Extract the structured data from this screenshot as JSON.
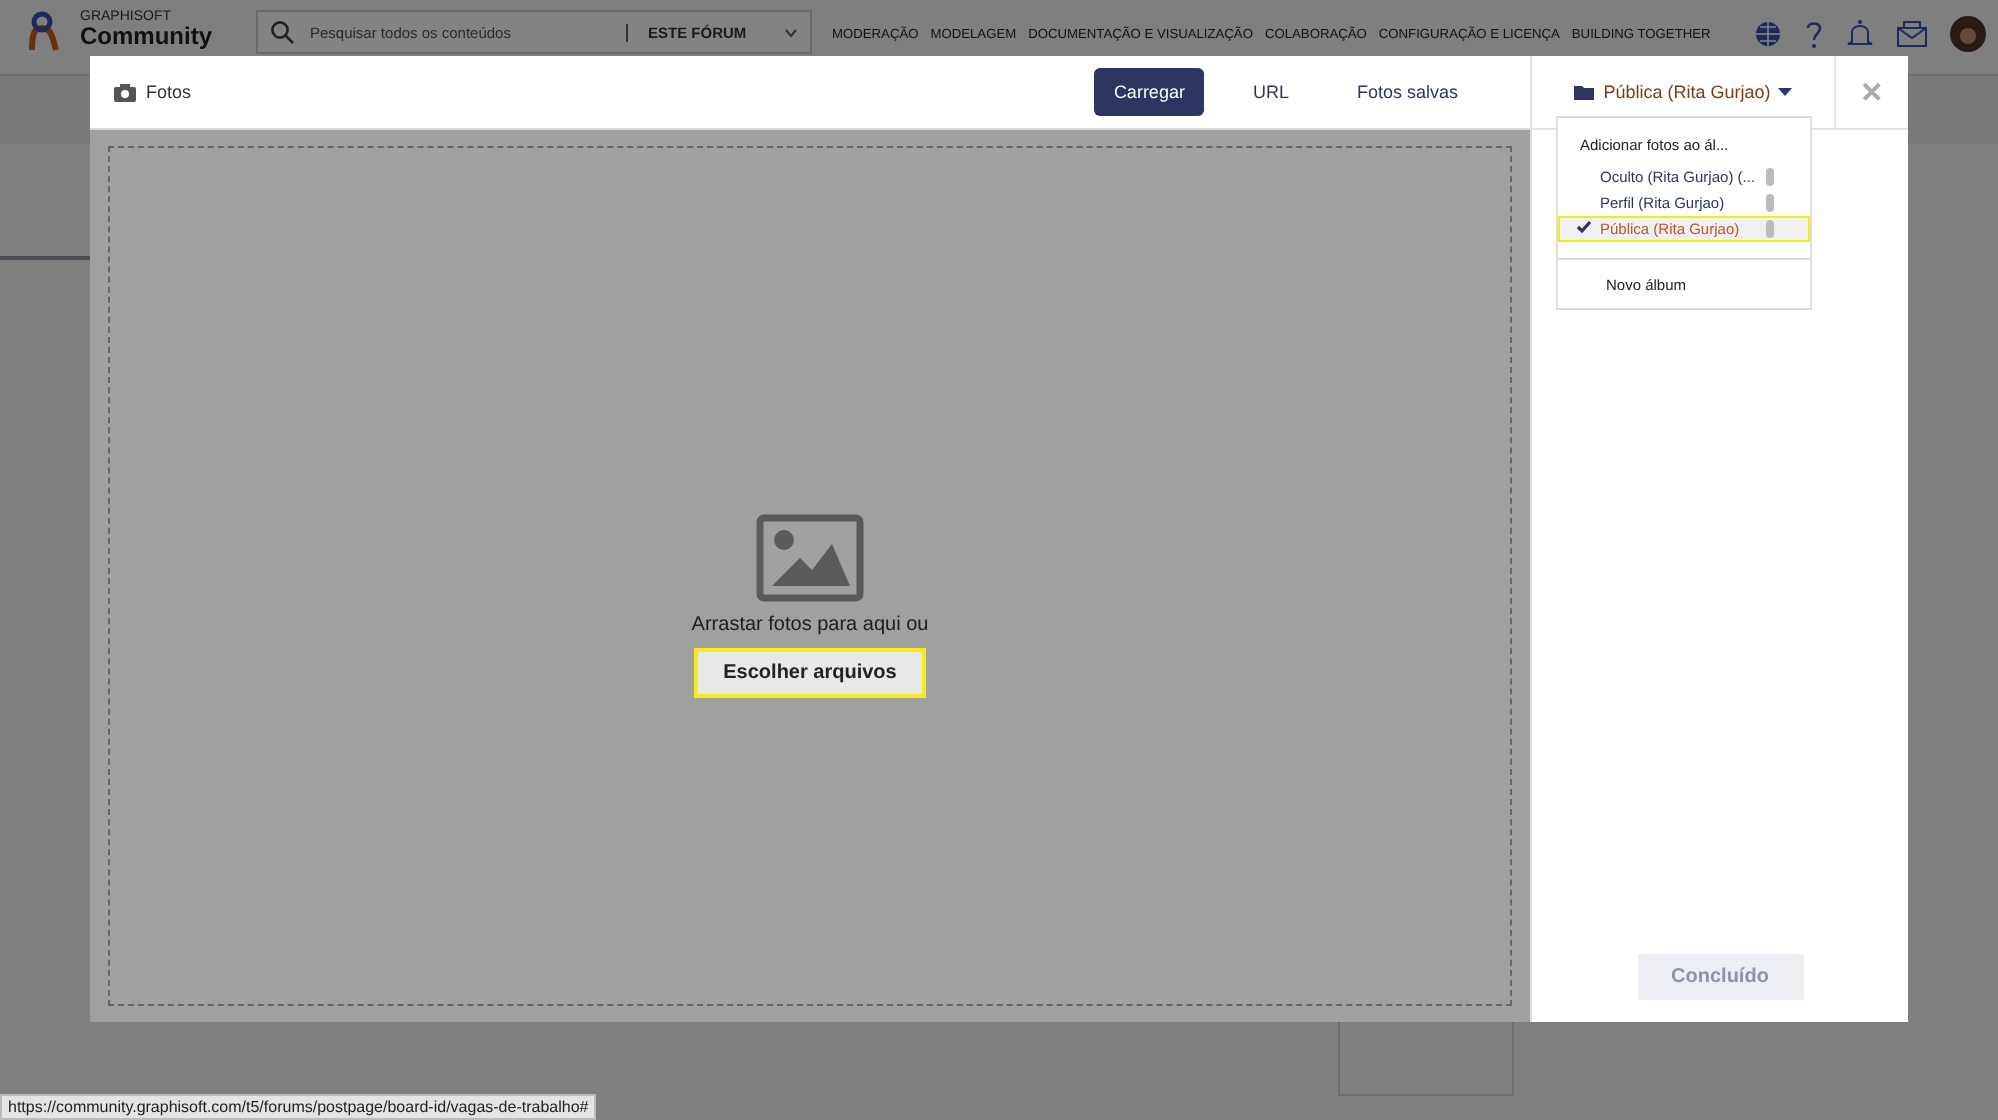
{
  "header": {
    "brand_top": "GRAPHISOFT",
    "brand_bottom": "Community",
    "search": {
      "placeholder": "Pesquisar todos os conteúdos"
    },
    "scope": "ESTE FÓRUM",
    "nav": [
      "MODERAÇÃO",
      "MODELAGEM",
      "DOCUMENTAÇÃO E VISUALIZAÇÃO",
      "COLABORAÇÃO",
      "CONFIGURAÇÃO E LICENÇA",
      "BUILDING TOGETHER"
    ]
  },
  "modal": {
    "title": "Fotos",
    "tabs": [
      {
        "label": "Carregar",
        "selected": true
      },
      {
        "label": "URL",
        "selected": false
      },
      {
        "label": "Fotos salvas",
        "selected": false
      }
    ],
    "drop_text": "Arrastar fotos para aqui ou",
    "choose_button": "Escolher arquivos",
    "album_button": "Pública (Rita Gurjao)",
    "album_menu": {
      "heading": "Adicionar fotos ao ál...",
      "items": [
        {
          "label": "Oculto (Rita Gurjao) (...",
          "selected": false
        },
        {
          "label": "Perfil (Rita Gurjao)",
          "selected": false
        },
        {
          "label": "Pública (Rita Gurjao)",
          "selected": true
        }
      ],
      "new_album": "Novo álbum"
    },
    "done_button": {
      "label": "Concluído",
      "disabled": true
    },
    "close_button": "✕"
  },
  "status_bar": "https://community.graphisoft.com/t5/forums/postpage/board-id/vagas-de-trabalho#"
}
